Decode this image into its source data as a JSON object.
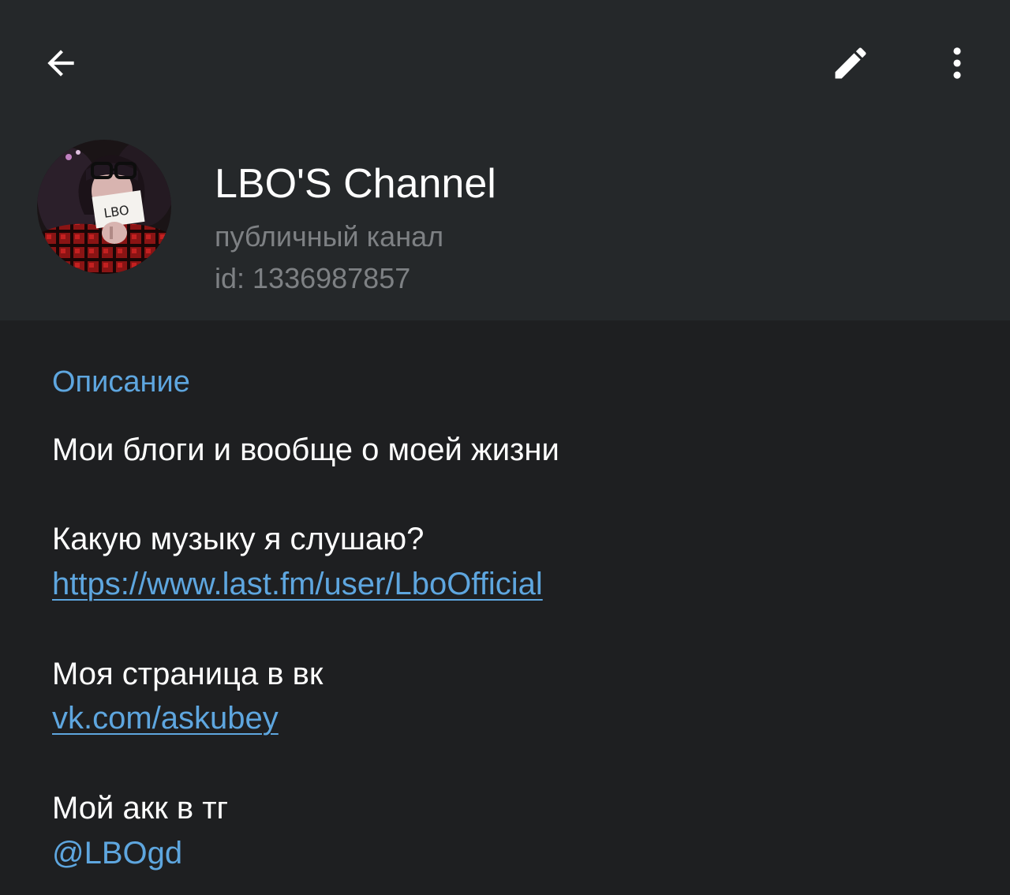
{
  "channel": {
    "title": "LBO'S Channel",
    "subtitle": "публичный канал",
    "id_text": "id: 1336987857"
  },
  "description": {
    "label": "Описание",
    "line1": "Мои блоги и вообще о моей жизни",
    "line2": "Какую музыку я слушаю?",
    "link1": "https://www.last.fm/user/LboOfficial",
    "line3": "Моя страница в вк",
    "link2": "vk.com/askubey",
    "line4": "Мой акк в тг",
    "mention": "@LBOgd"
  },
  "avatar": {
    "sign_text": "LBO"
  },
  "colors": {
    "header_bg": "#25282a",
    "body_bg": "#1e1f21",
    "accent": "#5ea6df",
    "secondary_text": "#7e8184"
  },
  "icons": {
    "back": "arrow-left-icon",
    "edit": "pencil-icon",
    "more": "more-vertical-icon"
  }
}
